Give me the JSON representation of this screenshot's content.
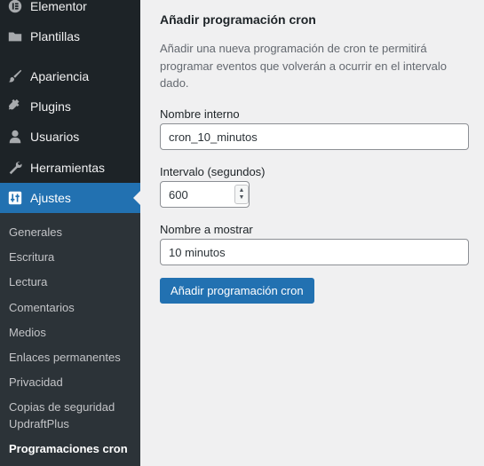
{
  "sidebar": {
    "menu": [
      {
        "label": "Elementor",
        "icon": "elementor-icon"
      },
      {
        "label": "Plantillas",
        "icon": "folder-icon"
      },
      {
        "label": "Apariencia",
        "icon": "paintbrush-icon"
      },
      {
        "label": "Plugins",
        "icon": "plugin-icon"
      },
      {
        "label": "Usuarios",
        "icon": "user-icon"
      },
      {
        "label": "Herramientas",
        "icon": "wrench-icon"
      },
      {
        "label": "Ajustes",
        "icon": "settings-sliders-icon"
      }
    ],
    "submenu": [
      {
        "label": "Generales"
      },
      {
        "label": "Escritura"
      },
      {
        "label": "Lectura"
      },
      {
        "label": "Comentarios"
      },
      {
        "label": "Medios"
      },
      {
        "label": "Enlaces permanentes"
      },
      {
        "label": "Privacidad"
      },
      {
        "label": "Copias de seguridad UpdraftPlus"
      },
      {
        "label": "Programaciones cron"
      }
    ]
  },
  "form": {
    "title": "Añadir programación cron",
    "description": "Añadir una nueva programación de cron te permitirá programar eventos que volverán a ocurrir en el intervalo dado.",
    "internal_name_label": "Nombre interno",
    "internal_name_value": "cron_10_minutos",
    "interval_label": "Intervalo (segundos)",
    "interval_value": "600",
    "display_name_label": "Nombre a mostrar",
    "display_name_value": "10 minutos",
    "submit_label": "Añadir programación cron"
  },
  "colors": {
    "sidebar_bg": "#1d2327",
    "submenu_bg": "#2c3338",
    "accent": "#2271b1",
    "page_bg": "#f0f0f1"
  }
}
